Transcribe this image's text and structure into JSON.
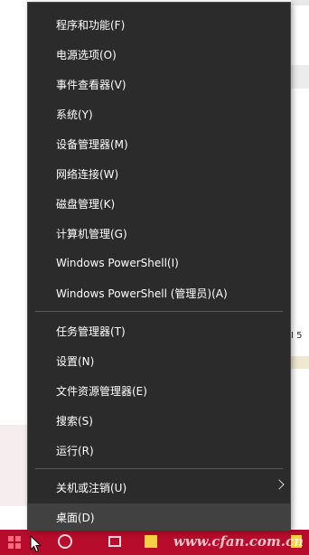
{
  "menu": {
    "items": [
      {
        "label": "程序和功能(F)"
      },
      {
        "label": "电源选项(O)"
      },
      {
        "label": "事件查看器(V)"
      },
      {
        "label": "系统(Y)"
      },
      {
        "label": "设备管理器(M)"
      },
      {
        "label": "网络连接(W)"
      },
      {
        "label": "磁盘管理(K)"
      },
      {
        "label": "计算机管理(G)"
      },
      {
        "label": "Windows PowerShell(I)"
      },
      {
        "label": "Windows PowerShell (管理员)(A)"
      },
      {
        "label": "任务管理器(T)"
      },
      {
        "label": "设置(N)"
      },
      {
        "label": "文件资源管理器(E)"
      },
      {
        "label": "搜索(S)"
      },
      {
        "label": "运行(R)"
      },
      {
        "label": "关机或注销(U)",
        "submenu": true
      },
      {
        "label": "桌面(D)",
        "highlighted": true
      }
    ]
  },
  "background": {
    "edge_text": "I  5"
  },
  "taskbar": {
    "color": "#b70c2b",
    "watermark": "www.cfan.com.cn"
  },
  "colors": {
    "menu_bg": "#2b2b2b",
    "menu_highlight": "#414141",
    "menu_text": "#ffffff",
    "separator": "#5a5a5a"
  }
}
